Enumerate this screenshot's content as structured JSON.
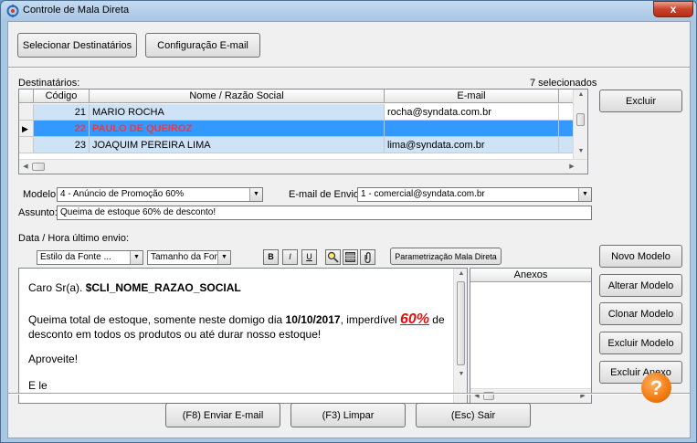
{
  "window": {
    "title": "Controle de Mala Direta",
    "close_label": "x"
  },
  "toolbar": {
    "select_label": "Selecionar Destinatários",
    "config_label": "Configuração E-mail"
  },
  "recipients": {
    "label": "Destinatários:",
    "selected_count": "7 selecionados",
    "columns": [
      "Código",
      "Nome / Razão Social",
      "E-mail"
    ],
    "rows": [
      {
        "code": "21",
        "name": "MARIO ROCHA",
        "email": "rocha@syndata.com.br"
      },
      {
        "code": "22",
        "name": "PAULO DE QUEIROZ",
        "email": ""
      },
      {
        "code": "23",
        "name": "JOAQUIM PEREIRA LIMA",
        "email": "lima@syndata.com.br"
      }
    ],
    "selected_row_text_color": "#ff3333",
    "selected_row_bg": "#3399ff",
    "row_bg": "#cfe3f6",
    "delete_label": "Excluir"
  },
  "form": {
    "model_label": "Modelo:",
    "model_value": "4 - Anúncio de Promoção 60%",
    "send_email_label": "E-mail de Envio:",
    "send_email_value": "1 - comercial@syndata.com.br",
    "subject_label": "Assunto:",
    "subject_value": "Queima de estoque 60% de desconto!",
    "last_send_label": "Data / Hora último envio:"
  },
  "editor_toolbar": {
    "font_style": "Estilo da Fonte ...",
    "font_size": "Tamanho da Fonte...",
    "bold": "B",
    "italic": "I",
    "underline": "U",
    "param_label": "Parametrização Mala Direta"
  },
  "message": {
    "greeting": "Caro Sr(a). ",
    "greeting_var": "$CLI_NOME_RAZAO_SOCIAL",
    "line1_a": "Queima total de estoque, somente neste domigo dia ",
    "line1_date": "10/10/2017",
    "line1_b": ", imperdível ",
    "line1_pct": "60%",
    "line1_c": " de",
    "line2": "desconto em todos os produtos ou até durar nosso estoque!",
    "line3": "Aproveite!",
    "line4": "E le",
    "pct_color": "#e01010"
  },
  "attachments": {
    "header": "Anexos"
  },
  "side_buttons": {
    "new_model": "Novo Modelo",
    "edit_model": "Alterar Modelo",
    "clone_model": "Clonar Modelo",
    "delete_model": "Excluir Modelo",
    "delete_attachment": "Excluir Anexo"
  },
  "footer": {
    "send_label": "(F8) Enviar E-mail",
    "clear_label": "(F3) Limpar",
    "exit_label": "(Esc) Sair",
    "help_label": "?"
  }
}
